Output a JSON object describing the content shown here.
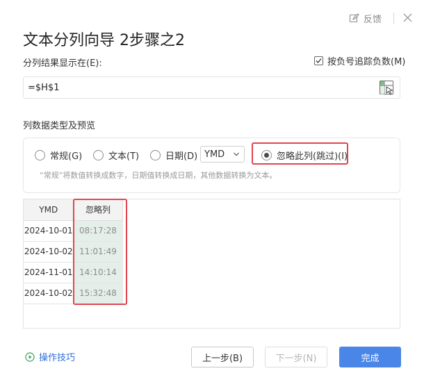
{
  "header": {
    "feedback_label": "反馈",
    "title": "文本分列向导 2步骤之2"
  },
  "destination": {
    "label": "分列结果显示在(E):",
    "value": "=$H$1",
    "negative_checkbox_label": "按负号追踪负数(M)",
    "negative_checked": true
  },
  "column_type": {
    "section_label": "列数据类型及预览",
    "options": {
      "general": "常规(G)",
      "text": "文本(T)",
      "date": "日期(D)",
      "skip": "忽略此列(跳过)(I)"
    },
    "selected": "skip",
    "date_format": "YMD",
    "hint": "“常规”将数值转换成数字，日期值转换成日期，其他数据转换为文本。"
  },
  "preview": {
    "headers": [
      "YMD",
      "忽略列"
    ],
    "rows": [
      [
        "2024-10-01",
        "08:17:28"
      ],
      [
        "2024-10-02",
        "11:01:49"
      ],
      [
        "2024-11-01",
        "14:10:14"
      ],
      [
        "2024-10-02",
        "15:32:48"
      ]
    ]
  },
  "footer": {
    "tips_label": "操作技巧",
    "prev_label": "上一步(B)",
    "next_label": "下一步(N)",
    "finish_label": "完成"
  },
  "colors": {
    "accent": "#4a86e8",
    "highlight": "#e0454f",
    "skip_column_bg": "#e5efe9",
    "link": "#2f6fd6"
  }
}
